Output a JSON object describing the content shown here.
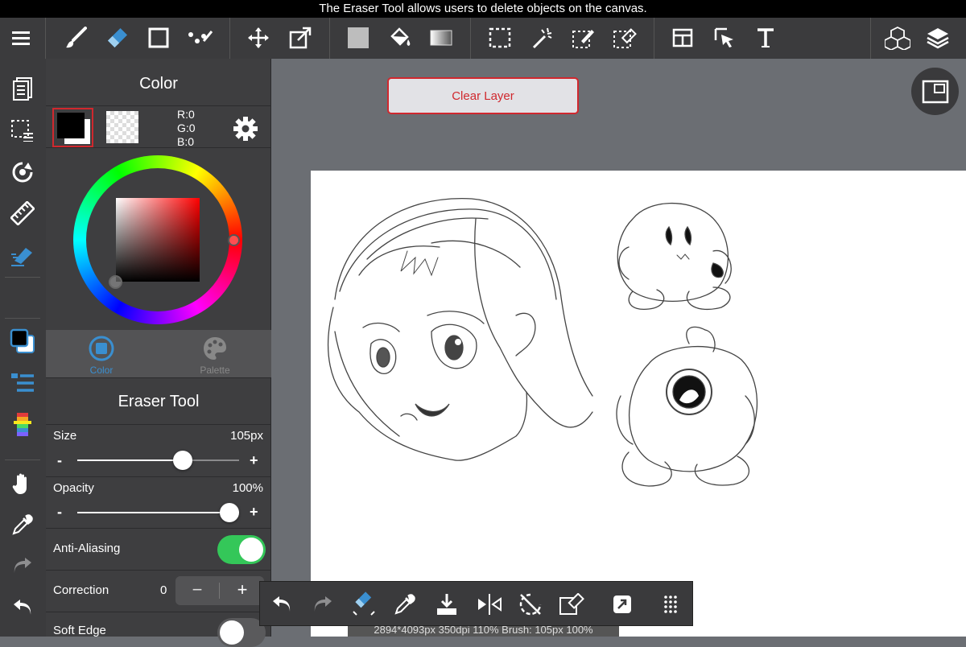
{
  "tooltip": "The Eraser Tool allows users to delete objects on the canvas.",
  "top_toolbar": {
    "icons": [
      "menu-icon",
      "brush-icon",
      "eraser-icon",
      "rectangle-icon",
      "dot-line-icon",
      "move-icon",
      "transform-icon",
      "fill-color-icon",
      "bucket-icon",
      "gradient-icon",
      "select-rect-icon",
      "magic-wand-icon",
      "select-pen-icon",
      "select-eraser-icon",
      "frame-icon",
      "operation-icon",
      "text-icon",
      "3d-material-icon",
      "layers-icon"
    ]
  },
  "left_rail": {
    "icons": [
      "pages-icon",
      "selection-icon",
      "rotate-icon",
      "ruler-icon",
      "snap-icon",
      "color-swatch-icon",
      "brush-list-icon",
      "palette-strip-icon",
      "hand-icon",
      "eyedropper-icon",
      "redo-icon",
      "undo-icon"
    ]
  },
  "color_panel": {
    "title": "Color",
    "rgb": {
      "r": "R:0",
      "g": "G:0",
      "b": "B:0"
    },
    "tabs": [
      {
        "label": "Color",
        "active": true
      },
      {
        "label": "Palette",
        "active": false
      }
    ]
  },
  "tool_panel": {
    "title": "Eraser Tool",
    "size": {
      "label": "Size",
      "value": "105px",
      "fraction": 0.67
    },
    "opacity": {
      "label": "Opacity",
      "value": "100%",
      "fraction": 1.0
    },
    "anti_aliasing": {
      "label": "Anti-Aliasing",
      "on": true
    },
    "correction": {
      "label": "Correction",
      "value": "0"
    },
    "soft_edge": {
      "label": "Soft Edge",
      "on": false
    }
  },
  "canvas": {
    "clear_layer_label": "Clear Layer",
    "status": "2894*4093px 350dpi 110% Brush: 105px 100%"
  },
  "bottom_bar": {
    "icons": [
      "undo-icon",
      "redo-icon",
      "eraser-transform-icon",
      "eyedropper-icon",
      "save-icon",
      "flip-icon",
      "rotate-lock-icon",
      "clear-icon",
      "share-icon",
      "more-icon"
    ]
  },
  "colors": {
    "accent": "#3a8fd0",
    "danger": "#d0282e",
    "toggle_on": "#34c759"
  }
}
